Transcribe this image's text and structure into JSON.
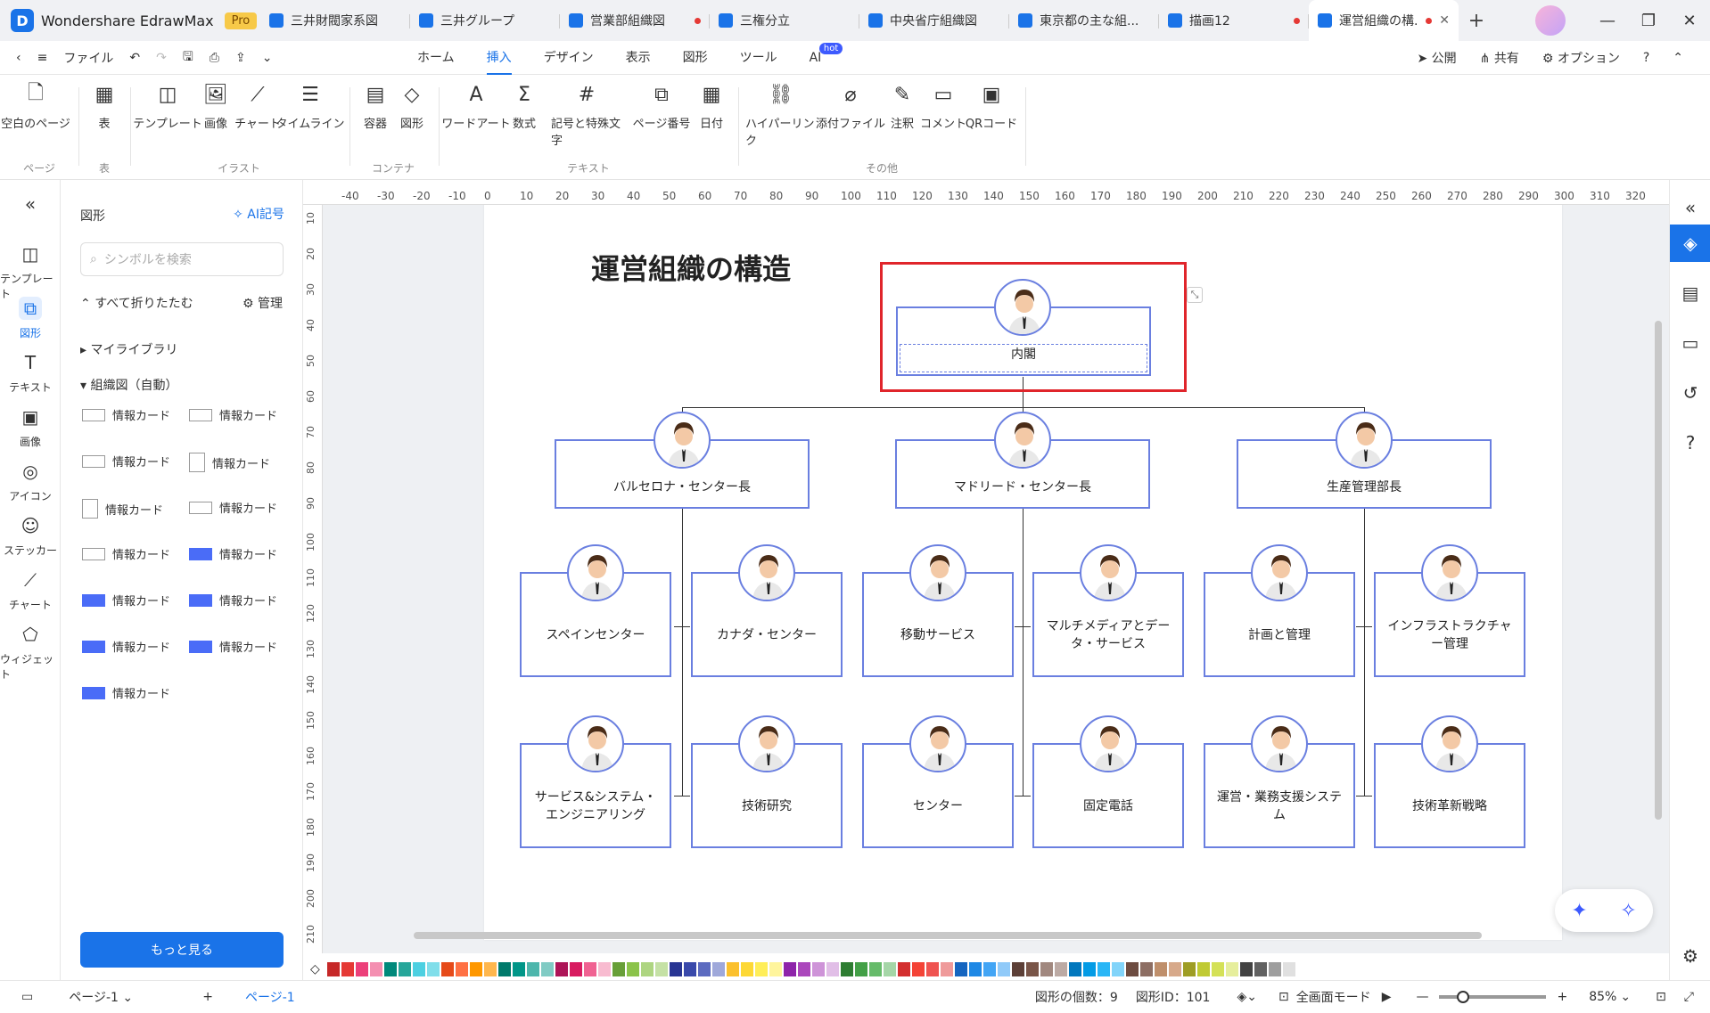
{
  "app": {
    "name": "Wondershare EdrawMax",
    "badge": "Pro"
  },
  "tabs": [
    {
      "label": "三井財閥家系図",
      "active": false,
      "unsaved": false
    },
    {
      "label": "三井グループ",
      "active": false,
      "unsaved": false
    },
    {
      "label": "営業部組織図",
      "active": false,
      "unsaved": true
    },
    {
      "label": "三権分立",
      "active": false,
      "unsaved": false
    },
    {
      "label": "中央省庁組織図",
      "active": false,
      "unsaved": false
    },
    {
      "label": "東京都の主な組...",
      "active": false,
      "unsaved": false
    },
    {
      "label": "描画12",
      "active": false,
      "unsaved": true
    },
    {
      "label": "運営組織の構...",
      "active": true,
      "unsaved": true
    }
  ],
  "menu": {
    "file": "ファイル",
    "tabs": [
      "ホーム",
      "挿入",
      "デザイン",
      "表示",
      "図形",
      "ツール",
      "AI"
    ],
    "active_tab": "挿入",
    "hot_badge": "hot",
    "publish": "公開",
    "share": "共有",
    "options": "オプション"
  },
  "ribbon": {
    "buttons": [
      {
        "label": "空白のページ",
        "icon": "blank-page-icon",
        "glyph": "🗋"
      },
      {
        "label": "表",
        "icon": "table-icon",
        "glyph": "▦"
      },
      {
        "label": "テンプレート",
        "icon": "template-icon",
        "glyph": "◫"
      },
      {
        "label": "画像",
        "icon": "image-icon",
        "glyph": "🖼"
      },
      {
        "label": "チャート",
        "icon": "chart-icon",
        "glyph": "⟋"
      },
      {
        "label": "タイムライン",
        "icon": "timeline-icon",
        "glyph": "☰"
      },
      {
        "label": "容器",
        "icon": "container-icon",
        "glyph": "▤"
      },
      {
        "label": "図形",
        "icon": "shapes-icon",
        "glyph": "◇"
      },
      {
        "label": "ワードアート",
        "icon": "wordart-icon",
        "glyph": "A"
      },
      {
        "label": "数式",
        "icon": "formula-icon",
        "glyph": "Σ"
      },
      {
        "label": "記号と特殊文字",
        "icon": "symbol-icon",
        "glyph": "#"
      },
      {
        "label": "ページ番号",
        "icon": "page-number-icon",
        "glyph": "⧉"
      },
      {
        "label": "日付",
        "icon": "date-icon",
        "glyph": "▦"
      },
      {
        "label": "ハイパーリンク",
        "icon": "hyperlink-icon",
        "glyph": "⛓"
      },
      {
        "label": "添付ファイル",
        "icon": "attachment-icon",
        "glyph": "⌀"
      },
      {
        "label": "注釈",
        "icon": "annotation-icon",
        "glyph": "✎"
      },
      {
        "label": "コメント",
        "icon": "comment-icon",
        "glyph": "▭"
      },
      {
        "label": "QRコード",
        "icon": "qr-code-icon",
        "glyph": "▣"
      }
    ],
    "groups": [
      "ページ",
      "表",
      "イラスト",
      "コンテナ",
      "テキスト",
      "その他"
    ]
  },
  "left_bar": [
    {
      "label": "テンプレート",
      "icon": "template-icon",
      "active": false
    },
    {
      "label": "図形",
      "icon": "shapes-icon",
      "active": true
    },
    {
      "label": "テキスト",
      "icon": "text-icon",
      "active": false
    },
    {
      "label": "画像",
      "icon": "image-icon",
      "active": false
    },
    {
      "label": "アイコン",
      "icon": "icon-library-icon",
      "active": false
    },
    {
      "label": "ステッカー",
      "icon": "sticker-icon",
      "active": false
    },
    {
      "label": "チャート",
      "icon": "chart-icon",
      "active": false
    },
    {
      "label": "ウィジェット",
      "icon": "widget-icon",
      "active": false
    }
  ],
  "library": {
    "title": "図形",
    "ai_button": "AI記号",
    "search_placeholder": "シンボルを検索",
    "collapse_all": "すべて折りたたむ",
    "manage": "管理",
    "my_library": "マイライブラリ",
    "section": "組織図（自動）",
    "card_label": "情報カード",
    "more": "もっと見る"
  },
  "canvas": {
    "title": "運営組織の構造",
    "root": "内閣",
    "level1": [
      "バルセロナ・センター長",
      "マドリード・センター長",
      "生産管理部長"
    ],
    "level2": [
      [
        "スペインセンター",
        "カナダ・センター",
        "サービス&システム・エンジニアリング",
        "技術研究"
      ],
      [
        "移動サービス",
        "マルチメディアとデータ・サービス",
        "センター",
        "固定電話"
      ],
      [
        "計画と管理",
        "インフラストラクチャー管理",
        "運営・業務支援システム",
        "技術革新戦略"
      ]
    ],
    "ruler_h": [
      "-40",
      "-30",
      "-20",
      "-10",
      "0",
      "10",
      "20",
      "30",
      "40",
      "50",
      "60",
      "70",
      "80",
      "90",
      "100",
      "110",
      "120",
      "130",
      "140",
      "150",
      "160",
      "170",
      "180",
      "190",
      "200",
      "210",
      "220",
      "230",
      "240",
      "250",
      "260",
      "270",
      "280",
      "290",
      "300",
      "310",
      "320"
    ],
    "ruler_v": [
      "10",
      "20",
      "30",
      "40",
      "50",
      "60",
      "70",
      "80",
      "90",
      "100",
      "110",
      "120",
      "130",
      "140",
      "150",
      "160",
      "170",
      "180",
      "190",
      "200",
      "210"
    ]
  },
  "palette": [
    "#c62828",
    "#e53935",
    "#ec407a",
    "#f48fb1",
    "#00897b",
    "#26a69a",
    "#4dd0e1",
    "#80deea",
    "#e64a19",
    "#ff7043",
    "#ff9800",
    "#ffb74d",
    "#00796b",
    "#009688",
    "#4db6ac",
    "#80cbc4",
    "#ad1457",
    "#d81b60",
    "#f06292",
    "#f8bbd0",
    "#689f38",
    "#8bc34a",
    "#aed581",
    "#c5e1a5",
    "#283593",
    "#3949ab",
    "#5c6bc0",
    "#9fa8da",
    "#fbc02d",
    "#fdd835",
    "#ffee58",
    "#fff59d",
    "#8e24aa",
    "#ab47bc",
    "#ce93d8",
    "#e1bee7",
    "#2e7d32",
    "#43a047",
    "#66bb6a",
    "#a5d6a7",
    "#d32f2f",
    "#f44336",
    "#ef5350",
    "#ef9a9a",
    "#1565c0",
    "#1e88e5",
    "#42a5f5",
    "#90caf9",
    "#5d4037",
    "#795548",
    "#a1887f",
    "#bcaaa4",
    "#0277bd",
    "#039be5",
    "#29b6f6",
    "#81d4fa",
    "#6d4c41",
    "#8d6e63",
    "#bf8f6b",
    "#d7a98a",
    "#9e9d24",
    "#c0ca33",
    "#d4e157",
    "#e6ee9c",
    "#424242",
    "#616161",
    "#9e9e9e",
    "#e0e0e0"
  ],
  "status": {
    "page_selector": "ページ-1",
    "page_tab": "ページ-1",
    "shape_count": "図形の個数：9",
    "shape_id": "図形ID：101",
    "fullscreen": "全画面モード",
    "zoom": "85%"
  },
  "colors": {
    "accent": "#1a73e8",
    "box_border": "#6a7fe0",
    "selection": "#e0252b"
  }
}
